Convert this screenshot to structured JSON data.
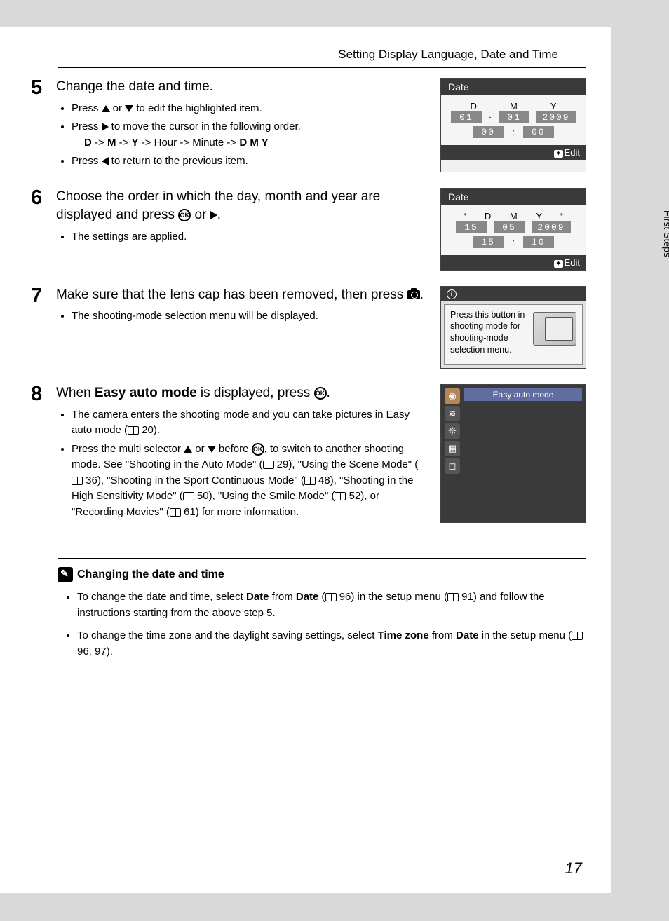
{
  "header": {
    "title": "Setting Display Language, Date and Time"
  },
  "side_tab": "First Steps",
  "page_number": "17",
  "steps": {
    "s5": {
      "num": "5",
      "title": "Change the date and time.",
      "b1a": "Press ",
      "b1b": " or ",
      "b1c": " to edit the highlighted item.",
      "b2a": "Press ",
      "b2b": " to move the cursor in the following order.",
      "b2c_d": "D",
      "b2c_sep1": " -> ",
      "b2c_m": "M",
      "b2c_sep2": " -> ",
      "b2c_y": "Y",
      "b2c_rest": " -> Hour -> Minute -> ",
      "b2c_dmy": "D M Y",
      "b3a": "Press ",
      "b3b": " to return to the previous item."
    },
    "s6": {
      "num": "6",
      "title_a": "Choose the order in which the day, month and year are displayed and press ",
      "title_b": " or ",
      "title_c": ".",
      "b1": "The settings are applied."
    },
    "s7": {
      "num": "7",
      "title_a": "Make sure that the lens cap has been removed, then press ",
      "title_b": ".",
      "b1": "The shooting-mode selection menu will be displayed."
    },
    "s8": {
      "num": "8",
      "title_a": "When ",
      "title_bold": "Easy auto mode",
      "title_b": " is displayed, press ",
      "title_c": ".",
      "b1a": "The camera enters the shooting mode and you can take pictures in Easy auto mode (",
      "b1ref": " 20).",
      "b2a": "Press the multi selector ",
      "b2b": " or ",
      "b2c": " before ",
      "b2d": ", to switch to another shooting mode. See \"Shooting in the Auto Mode\" (",
      "b2r1": " 29), \"Using the Scene Mode\" (",
      "b2r2": " 36), \"Shooting in the Sport Continuous Mode\" (",
      "b2r3": " 48), \"Shooting in the High Sensitivity Mode\" (",
      "b2r4": " 50), \"Using the Smile Mode\" (",
      "b2r5": " 52), or \"Recording Movies\" (",
      "b2r6": " 61) for more information."
    }
  },
  "lcd5": {
    "title": "Date",
    "d_lab": "D",
    "m_lab": "M",
    "y_lab": "Y",
    "d": "01",
    "m": "01",
    "y": "2009",
    "hh": "00",
    "mm": "00",
    "edit": "Edit"
  },
  "lcd6": {
    "title": "Date",
    "d_lab": "D",
    "m_lab": "M",
    "y_lab": "Y",
    "d": "15",
    "m": "05",
    "y": "2009",
    "hh": "15",
    "mm": "10",
    "edit": "Edit"
  },
  "info7": {
    "text": "Press this button in shooting mode for shooting-mode selection menu."
  },
  "mode8": {
    "label": "Easy auto mode"
  },
  "note": {
    "title": "Changing the date and time",
    "l1a": "To change the date and time, select ",
    "l1b1": "Date",
    "l1c": " from ",
    "l1b2": "Date",
    "l1d": " (",
    "l1r1": " 96) in the setup menu (",
    "l1r2": " 91) and follow the instructions starting from the above step 5.",
    "l2a": "To change the time zone and the daylight saving settings, select ",
    "l2b1": "Time zone",
    "l2c": " from ",
    "l2b2": "Date",
    "l2d": " in the setup menu (",
    "l2r": " 96, 97)."
  }
}
